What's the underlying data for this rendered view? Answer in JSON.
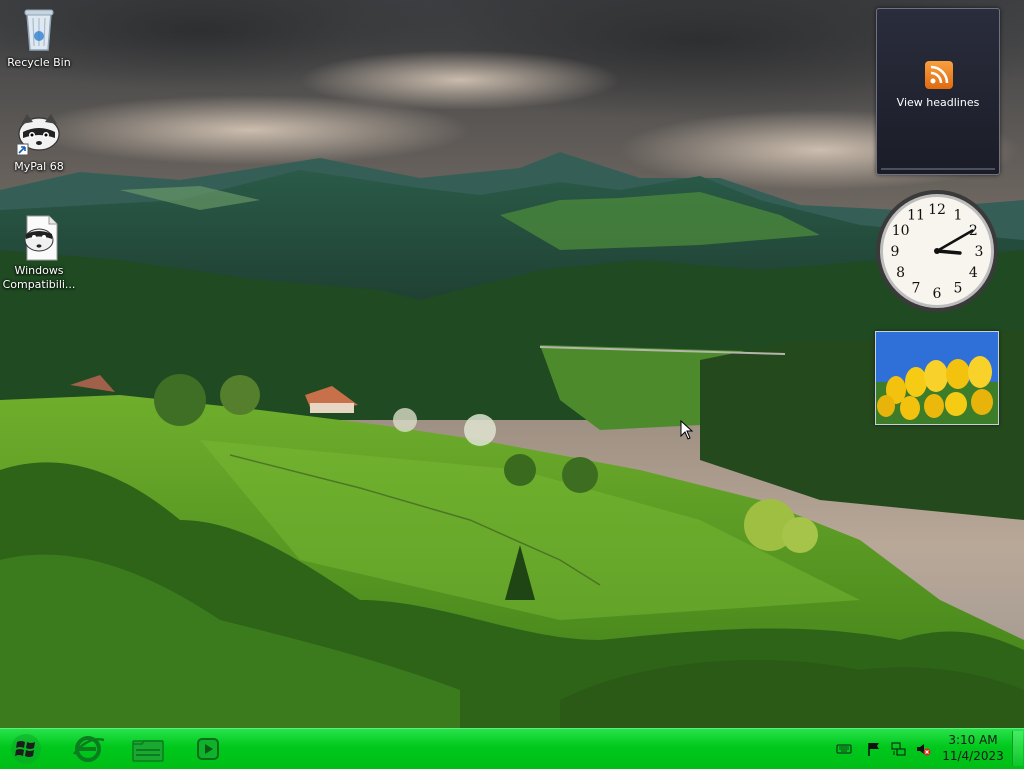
{
  "desktop": {
    "icons": [
      {
        "label": "Recycle Bin"
      },
      {
        "label": "MyPal 68"
      },
      {
        "label": "Windows Compatibili..."
      }
    ]
  },
  "gadgets": {
    "feed": {
      "label": "View headlines"
    },
    "clock": {
      "hour": 3,
      "minute": 10,
      "numerals": [
        "12",
        "1",
        "2",
        "3",
        "4",
        "5",
        "6",
        "7",
        "8",
        "9",
        "10",
        "11"
      ]
    },
    "slideshow": {
      "subject": "yellow tulips"
    }
  },
  "taskbar": {
    "color": "#00c81c",
    "pinned": [
      {
        "name": "internet-explorer-icon"
      },
      {
        "name": "windows-explorer-icon"
      },
      {
        "name": "media-player-icon"
      }
    ],
    "tray": {
      "icons": [
        "keyboard-icon",
        "action-center-flag-icon",
        "network-icon",
        "volume-muted-icon"
      ],
      "time": "3:10 AM",
      "date": "11/4/2023"
    }
  }
}
